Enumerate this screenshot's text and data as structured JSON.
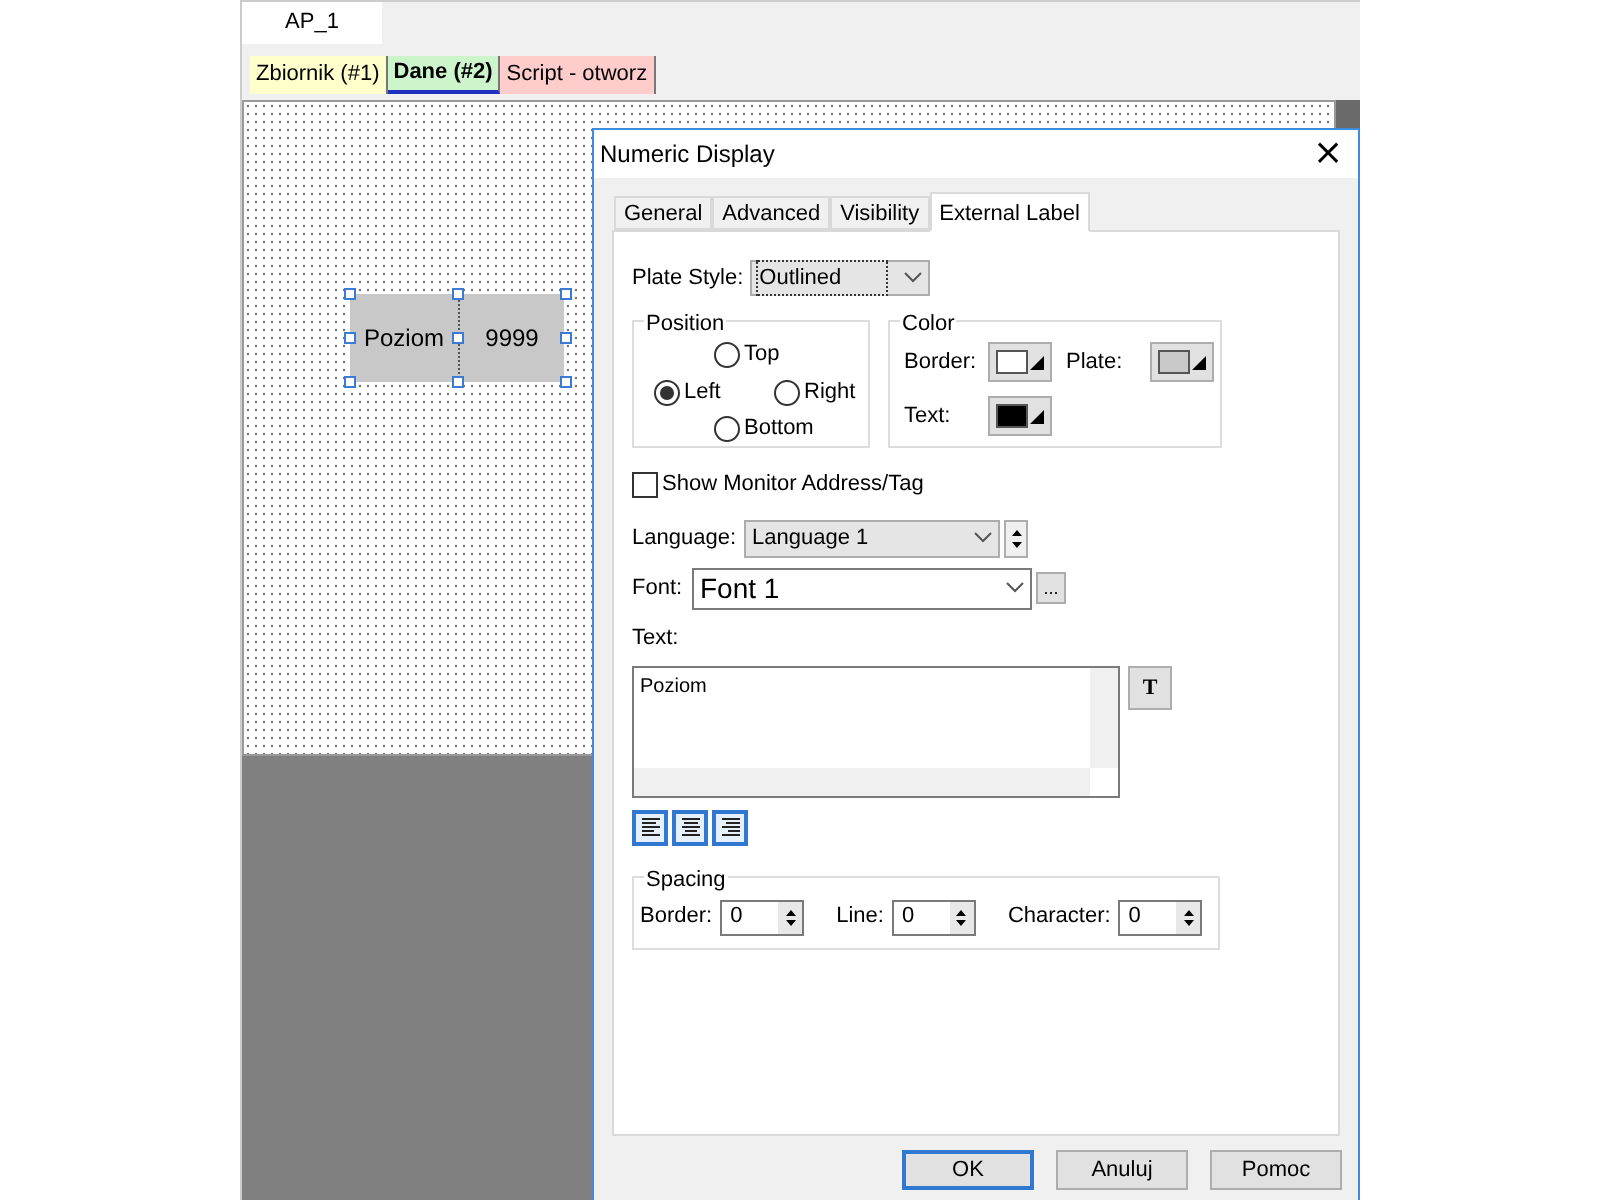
{
  "document_tabs": [
    {
      "label": "AP_1",
      "selected": true
    }
  ],
  "sheet_tabs": [
    {
      "label": "Zbiornik (#1)",
      "selected": false,
      "color": "#ffffcc"
    },
    {
      "label": "Dane (#2)",
      "selected": true,
      "color": "#ccf5cc"
    },
    {
      "label": "Script - otworz",
      "selected": false,
      "color": "#ffcccc"
    }
  ],
  "canvas_objects": [
    {
      "kind": "label",
      "text": "Poziom"
    },
    {
      "kind": "value",
      "text": "9999"
    }
  ],
  "dialog": {
    "title": "Numeric Display",
    "close": "×",
    "tabs": [
      {
        "label": "General",
        "selected": false
      },
      {
        "label": "Advanced",
        "selected": false
      },
      {
        "label": "Visibility",
        "selected": false
      },
      {
        "label": "External Label",
        "selected": true
      }
    ],
    "plate_style": {
      "label": "Plate Style:",
      "value": "Outlined"
    },
    "position": {
      "title": "Position",
      "options": [
        {
          "label": "Top",
          "selected": false
        },
        {
          "label": "Left",
          "selected": true
        },
        {
          "label": "Right",
          "selected": false
        },
        {
          "label": "Bottom",
          "selected": false
        }
      ]
    },
    "color": {
      "title": "Color",
      "swatches": [
        {
          "label": "Border:",
          "color": "#ffffff"
        },
        {
          "label": "Plate:",
          "color": "#c8c8c8"
        },
        {
          "label": "Text:",
          "color": "#000000"
        }
      ]
    },
    "show_monitor": {
      "label": "Show Monitor Address/Tag",
      "checked": false
    },
    "language": {
      "label": "Language:",
      "value": "Language 1"
    },
    "font": {
      "label": "Font:",
      "value": "Font 1",
      "browse": "..."
    },
    "text": {
      "label": "Text:",
      "value": "Poziom",
      "style_button": "T"
    },
    "spacing": {
      "title": "Spacing",
      "fields": [
        {
          "label": "Border:",
          "value": "0"
        },
        {
          "label": "Line:",
          "value": "0"
        },
        {
          "label": "Character:",
          "value": "0"
        }
      ]
    },
    "buttons": [
      {
        "label": "OK",
        "default": true
      },
      {
        "label": "Anuluj",
        "default": false
      },
      {
        "label": "Pomoc",
        "default": false
      }
    ]
  }
}
